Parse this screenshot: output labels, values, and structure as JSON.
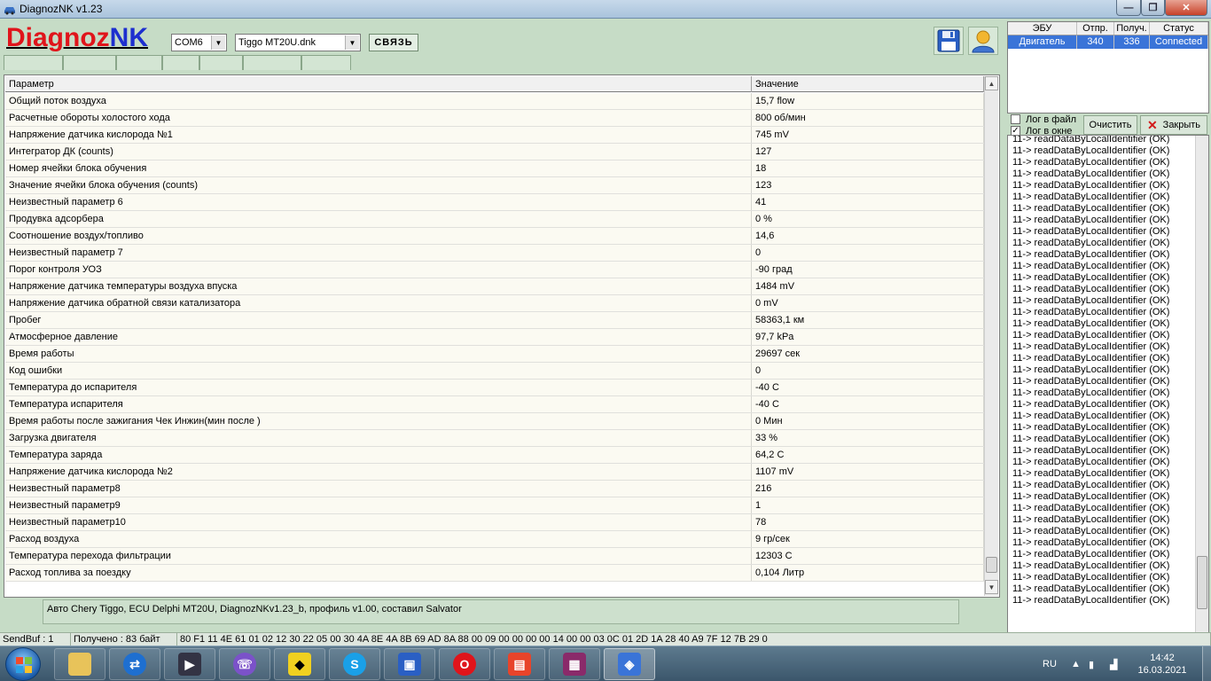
{
  "window": {
    "title": "DiagnozNK v1.23"
  },
  "toolbar": {
    "logo_part1": "Diagnoz",
    "logo_part2": "NK",
    "port_value": "COM6",
    "profile_value": "Tiggo MT20U.dnk",
    "connect_label": "СВЯЗЬ",
    "save_icon": "floppy-disk-icon",
    "user_icon": "user-icon"
  },
  "grid": {
    "col_param": "Параметр",
    "col_value": "Значение",
    "rows": [
      {
        "p": "Общий поток воздуха",
        "v": "15,7 flow"
      },
      {
        "p": "Расчетные обороты холостого хода",
        "v": "800 об/мин"
      },
      {
        "p": "Напряжение датчика кислорода №1",
        "v": "745 mV"
      },
      {
        "p": "Интегратор ДК (counts)",
        "v": "127"
      },
      {
        "p": "Номер ячейки блока обучения",
        "v": "18"
      },
      {
        "p": "Значение ячейки блока обучения (counts)",
        "v": "123"
      },
      {
        "p": "Неизвестный параметр 6",
        "v": "41"
      },
      {
        "p": "Продувка адсорбера",
        "v": "0 %"
      },
      {
        "p": "Соотношение воздух/топливо",
        "v": "14,6"
      },
      {
        "p": "Неизвестный параметр 7",
        "v": "0"
      },
      {
        "p": "Порог контроля УОЗ",
        "v": "-90 град"
      },
      {
        "p": "Напряжение датчика температуры воздуха впуска",
        "v": "1484 mV"
      },
      {
        "p": "Напряжение датчика обратной связи катализатора",
        "v": "0 mV"
      },
      {
        "p": "Пробег",
        "v": "58363,1 км"
      },
      {
        "p": "Атмосферное давление",
        "v": "97,7 kPa"
      },
      {
        "p": "Время работы",
        "v": "29697 сек"
      },
      {
        "p": "Код ошибки",
        "v": "0"
      },
      {
        "p": "Температура до испарителя",
        "v": "-40 C"
      },
      {
        "p": "Температура испарителя",
        "v": "-40 C"
      },
      {
        "p": "Время работы после зажигания Чек Инжин(мин после )",
        "v": "0 Мин"
      },
      {
        "p": "Загрузка двигателя",
        "v": "33 %"
      },
      {
        "p": "Температура заряда",
        "v": "64,2 C"
      },
      {
        "p": "Напряжение датчика кислорода №2",
        "v": "1107 mV"
      },
      {
        "p": "Неизвестный параметр8",
        "v": "216"
      },
      {
        "p": "Неизвестный параметр9",
        "v": "1"
      },
      {
        "p": "Неизвестный параметр10",
        "v": "78"
      },
      {
        "p": "Расход воздуха",
        "v": "9 гр/сек"
      },
      {
        "p": "Температура перехода фильтрации",
        "v": "12303 C"
      },
      {
        "p": "Расход топлива за поездку",
        "v": "0,104 Литр"
      }
    ]
  },
  "info_text": "Авто Chery Tiggo,  ECU Delphi MT20U,  DiagnozNKv1.23_b, профиль v1.00,  составил Salvator",
  "ecu_table": {
    "headers": [
      "ЭБУ",
      "Отпр.",
      "Получ.",
      "Статус"
    ],
    "row": [
      "Двигатель",
      "340",
      "336",
      "Connected"
    ]
  },
  "log_panel": {
    "log_to_file": "Лог в файл",
    "log_in_window": "Лог в окне",
    "clear_label": "Очистить",
    "close_label": "Закрыть",
    "line": "11-> readDataByLocalIdentifier (OK)"
  },
  "statusbar": {
    "sendbuf": "SendBuf : 1",
    "received": "Получено : 83 байт",
    "bytes": "80 F1 11 4E 61 01 02 12 30 22 05 00 30 4A 8E 4A 8B 69 AD 8A 88 00 09 00 00 00 00 14 00 00 03 0C 01 2D 1A 28 40 A9 7F 12 7B 29 0"
  },
  "taskbar": {
    "lang": "RU",
    "time": "14:42",
    "date": "16.03.2021",
    "apps": [
      "file-explorer-icon",
      "teamviewer-icon",
      "video-pro-icon",
      "viber-icon",
      "batman-icon",
      "skype-icon",
      "floppy-icon",
      "opera-icon",
      "presentation-icon",
      "winrar-icon",
      "diagnoznk-icon"
    ]
  }
}
